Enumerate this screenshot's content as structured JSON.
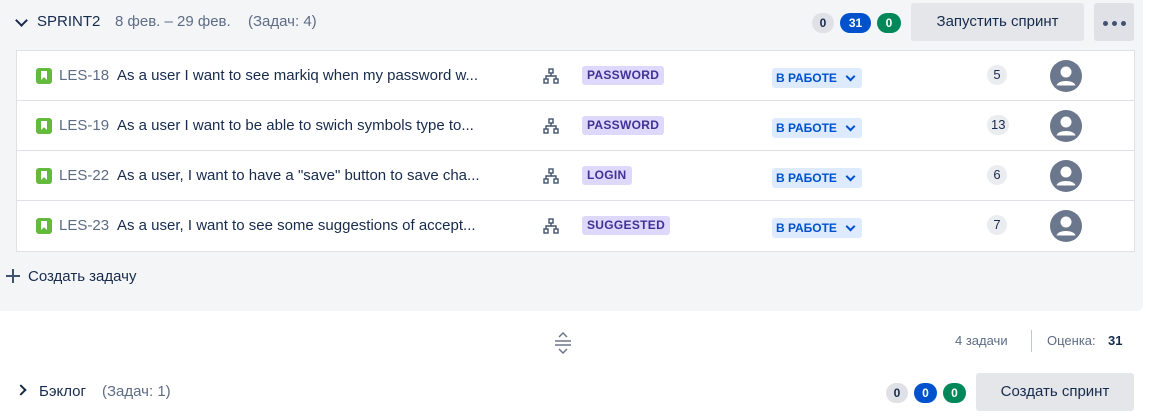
{
  "sprint": {
    "name": "SPRINT2",
    "dates": "8 фев. – 29 фев.",
    "count": "(Задач: 4)",
    "pills": {
      "todo": "0",
      "in_progress": "31",
      "done": "0"
    },
    "start_label": "Запустить спринт",
    "colors": {
      "todo": "#dfe1e6",
      "in_progress": "#0052cc",
      "done": "#00875a"
    }
  },
  "issues": [
    {
      "key": "LES-18",
      "summary": "As a user I want to see markiq when my password w...",
      "epic": "PASSWORD",
      "status": "В РАБОТЕ",
      "points": "5"
    },
    {
      "key": "LES-19",
      "summary": "As a user I want to be able to swich symbols type to...",
      "epic": "PASSWORD",
      "status": "В РАБОТЕ",
      "points": "13"
    },
    {
      "key": "LES-22",
      "summary": "As a user, I want to have a \"save\" button to save cha...",
      "epic": "LOGIN",
      "status": "В РАБОТЕ",
      "points": "6"
    },
    {
      "key": "LES-23",
      "summary": "As a user, I want to see some suggestions of accept...",
      "epic": "SUGGESTED",
      "status": "В РАБОТЕ",
      "points": "7"
    }
  ],
  "create_issue_label": "Создать задачу",
  "footer": {
    "count": "4 задачи",
    "estimate_label": "Оценка:",
    "estimate_value": "31"
  },
  "backlog": {
    "name": "Бэклог",
    "count": "(Задач: 1)",
    "pills": {
      "todo": "0",
      "in_progress": "0",
      "done": "0"
    },
    "create_sprint_label": "Создать спринт"
  },
  "icons": [
    "chevron-down-icon",
    "story-icon",
    "hierarchy-icon",
    "avatar-icon",
    "plus-icon",
    "resize-handle-icon",
    "chevron-right-icon",
    "more-icon"
  ]
}
